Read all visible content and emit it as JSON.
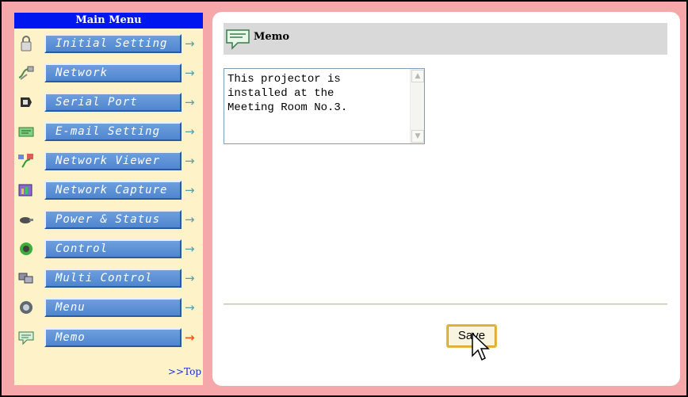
{
  "menu": {
    "header": "Main Menu",
    "items": [
      {
        "label": "Initial Setting",
        "icon": "lock-icon",
        "active": false
      },
      {
        "label": "Network",
        "icon": "network-cable-icon",
        "active": false
      },
      {
        "label": "Serial Port",
        "icon": "serial-port-icon",
        "active": false
      },
      {
        "label": "E-mail Setting",
        "icon": "email-icon",
        "active": false
      },
      {
        "label": "Network Viewer",
        "icon": "network-viewer-icon",
        "active": false
      },
      {
        "label": "Network Capture",
        "icon": "network-capture-icon",
        "active": false
      },
      {
        "label": "Power & Status",
        "icon": "power-status-icon",
        "active": false
      },
      {
        "label": "Control",
        "icon": "control-icon",
        "active": false
      },
      {
        "label": "Multi Control",
        "icon": "multi-control-icon",
        "active": false
      },
      {
        "label": "Menu",
        "icon": "menu-icon",
        "active": false
      },
      {
        "label": "Memo",
        "icon": "memo-icon",
        "active": true
      }
    ],
    "arrow": "→",
    "top_link": ">>Top"
  },
  "page": {
    "title": "Memo",
    "title_icon": "memo-icon"
  },
  "memo": {
    "text": "This projector is\ninstalled at the\nMeeting Room No.3."
  },
  "actions": {
    "save_label": "Save"
  },
  "colors": {
    "frame": "#f6a7a9",
    "menu_bg": "#fdf2c8",
    "menu_header": "#0018f0",
    "menu_button": "#5b8fd5",
    "arrow": "#58a0a8",
    "active_arrow": "#f15a10",
    "title_bar": "#d9d9d9"
  }
}
